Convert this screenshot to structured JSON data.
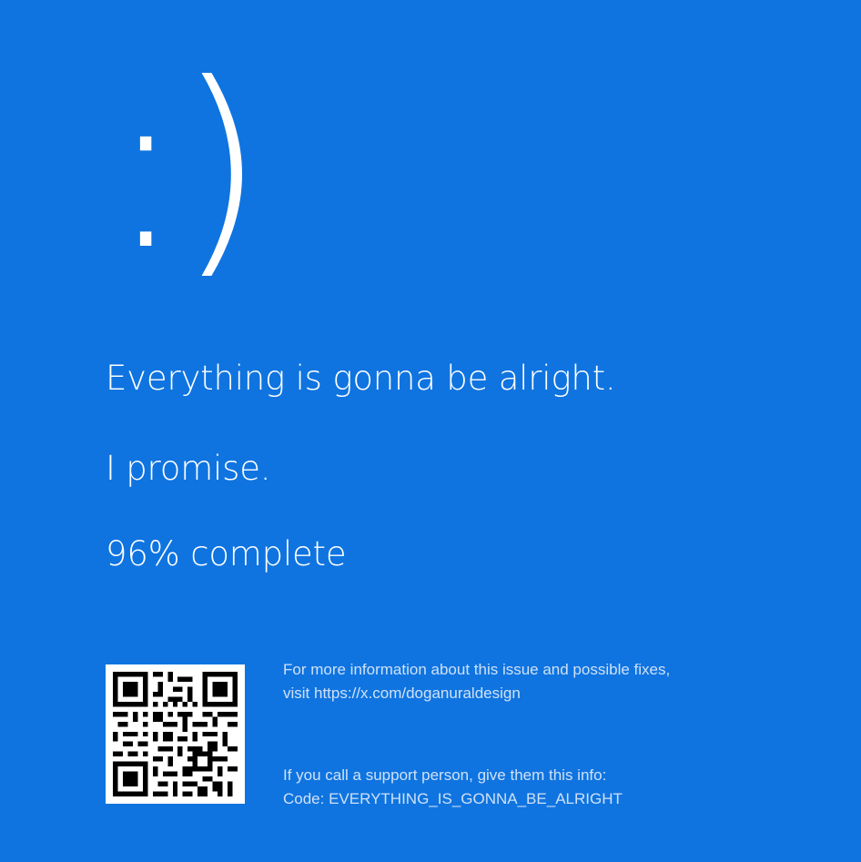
{
  "colors": {
    "background": "#0f74e0",
    "foreground": "#ffffff",
    "secondary_text": "#cfe1f7"
  },
  "emoticon": ":)",
  "messages": {
    "line1": "Everything is gonna be alright.",
    "line2": "I promise.",
    "progress": "96% complete",
    "progress_percent": 96
  },
  "qr_code": {
    "icon": "qr-code-icon"
  },
  "more_info": {
    "line1": "For more information about this issue and possible fixes,",
    "line2": "visit https://x.com/doganuraldesign"
  },
  "support": {
    "line1": "If you call a support person, give them this info:",
    "line2": "Code: EVERYTHING_IS_GONNA_BE_ALRIGHT"
  }
}
